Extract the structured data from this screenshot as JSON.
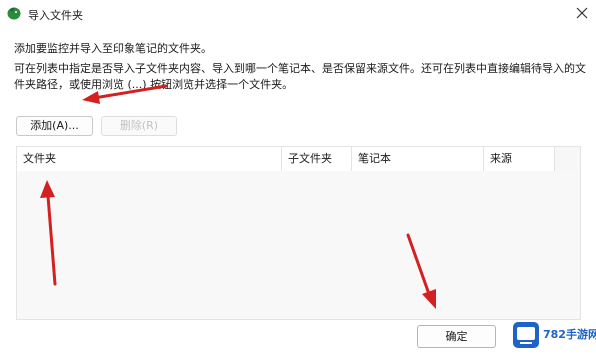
{
  "window": {
    "title": "导入文件夹",
    "app_icon": "evernote-elephant-icon",
    "close_icon": "close-icon"
  },
  "prompt": "添加要监控并导入至印象笔记的文件夹。",
  "description": "可在列表中指定是否导入子文件夹内容、导入到哪一个笔记本、是否保留来源文件。还可在列表中直接编辑待导入的文件夹路径，或使用浏览 (...) 按钮浏览并选择一个文件夹。",
  "buttons": {
    "add": "添加(A)...",
    "remove": "删除(R)",
    "ok": "确定"
  },
  "table": {
    "columns": [
      "文件夹",
      "子文件夹",
      "笔记本",
      "来源"
    ]
  },
  "watermark": {
    "text": "782手游网",
    "logo_text": "782"
  },
  "colors": {
    "annotation_arrow": "#d42020",
    "watermark_blue": "#1e63c6",
    "app_icon_green": "#2b8a3e"
  }
}
